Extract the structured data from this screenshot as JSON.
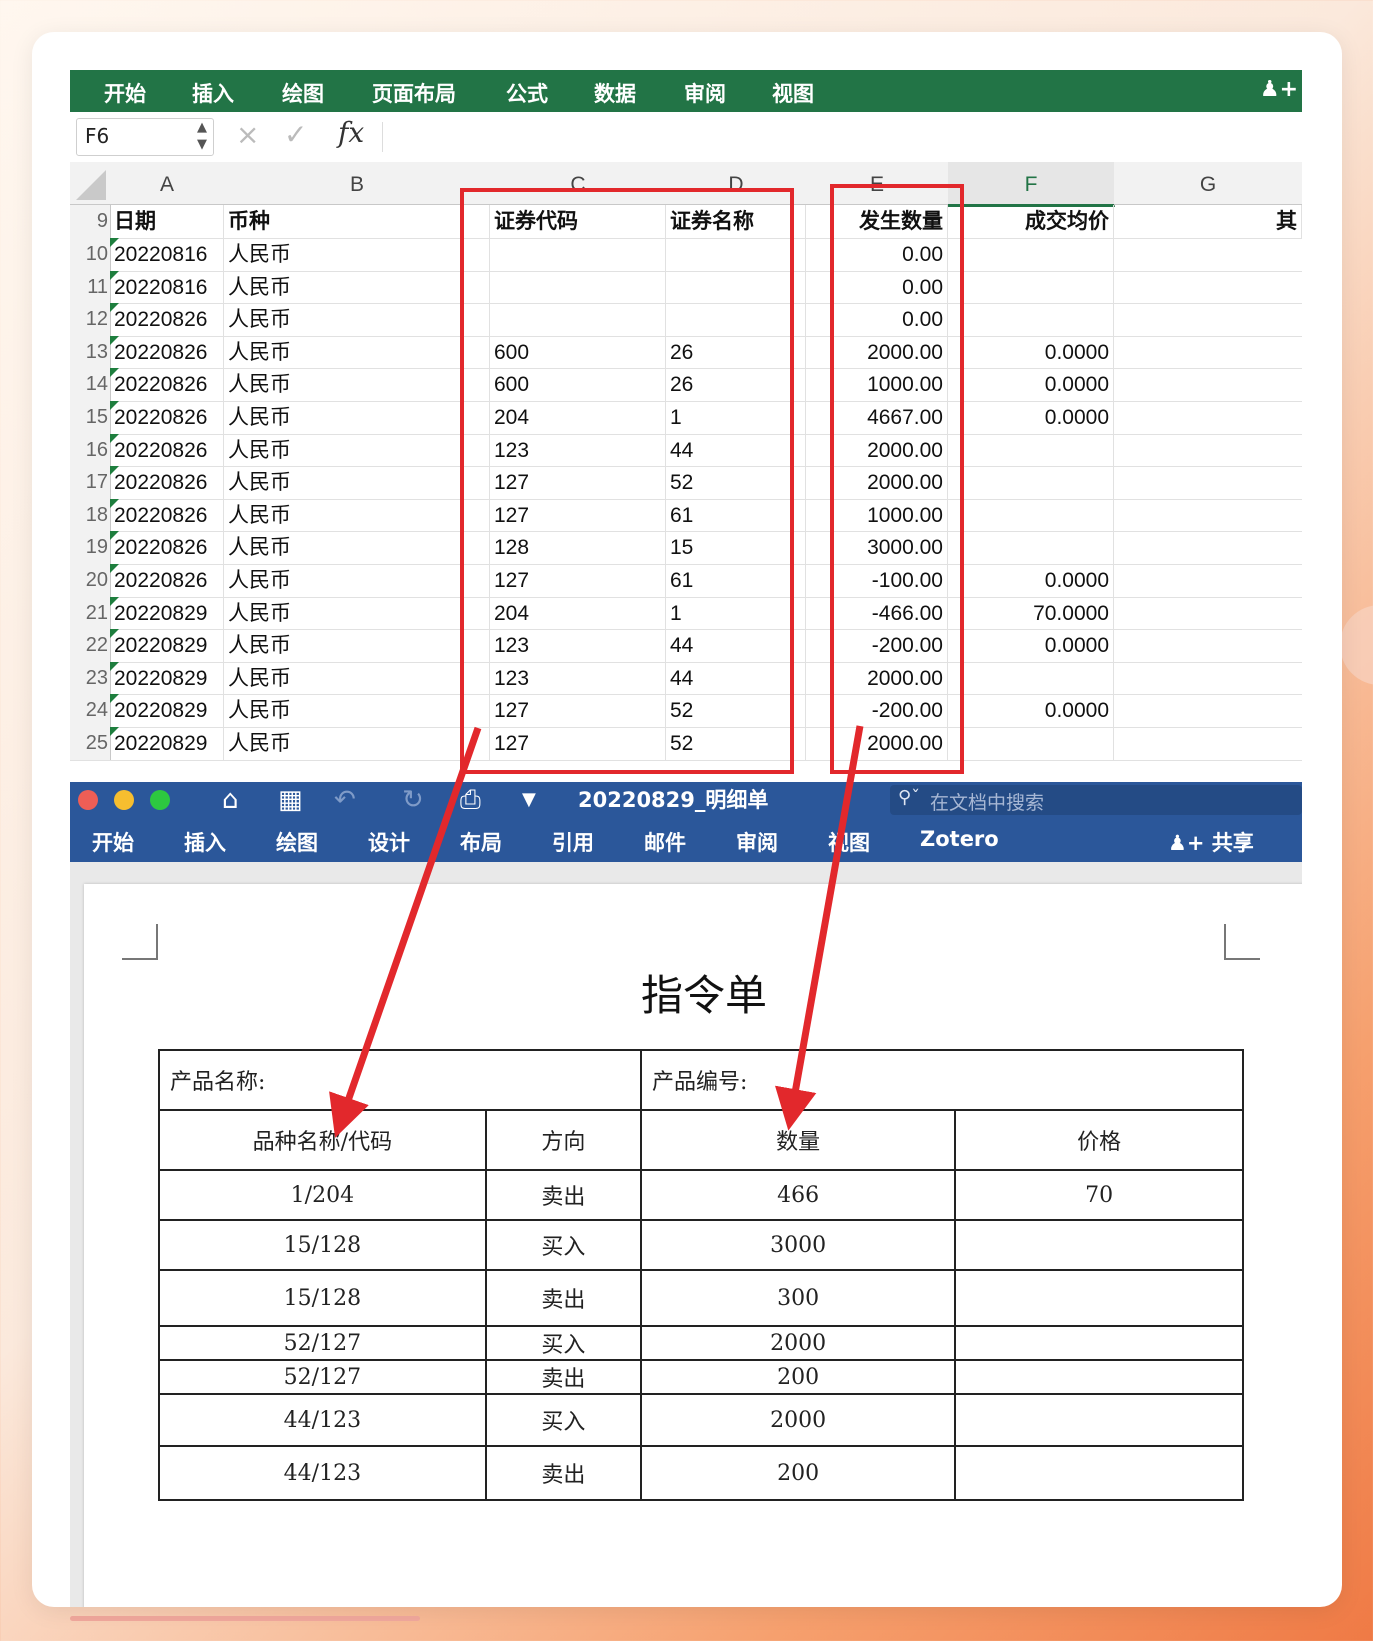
{
  "excel": {
    "ribbon_tabs": [
      "开始",
      "插入",
      "绘图",
      "页面布局",
      "公式",
      "数据",
      "审阅",
      "视图"
    ],
    "share_icon": "add-person-icon",
    "name_box": "F6",
    "formula_icons": {
      "cancel": "×",
      "confirm": "✓",
      "fx": "fx"
    },
    "columns": [
      "A",
      "B",
      "C",
      "D",
      "E",
      "F",
      "G"
    ],
    "selected_column": "F",
    "header_row": {
      "row": "9",
      "date": "日期",
      "currency": "币种",
      "code": "证券代码",
      "name": "证券名称",
      "qty": "发生数量",
      "avg_price": "成交均价",
      "other": "其"
    },
    "rows": [
      {
        "row": "10",
        "date": "20220816",
        "currency": "人民币",
        "code": "",
        "name": "",
        "qty": "0.00",
        "avg_price": ""
      },
      {
        "row": "11",
        "date": "20220816",
        "currency": "人民币",
        "code": "",
        "name": "",
        "qty": "0.00",
        "avg_price": ""
      },
      {
        "row": "12",
        "date": "20220826",
        "currency": "人民币",
        "code": "",
        "name": "",
        "qty": "0.00",
        "avg_price": ""
      },
      {
        "row": "13",
        "date": "20220826",
        "currency": "人民币",
        "code": "600",
        "name": "26",
        "qty": "2000.00",
        "avg_price": "0.0000"
      },
      {
        "row": "14",
        "date": "20220826",
        "currency": "人民币",
        "code": "600",
        "name": "26",
        "qty": "1000.00",
        "avg_price": "0.0000"
      },
      {
        "row": "15",
        "date": "20220826",
        "currency": "人民币",
        "code": "204",
        "name": "1",
        "qty": "4667.00",
        "avg_price": "0.0000"
      },
      {
        "row": "16",
        "date": "20220826",
        "currency": "人民币",
        "code": "123",
        "name": "44",
        "qty": "2000.00",
        "avg_price": ""
      },
      {
        "row": "17",
        "date": "20220826",
        "currency": "人民币",
        "code": "127",
        "name": "52",
        "qty": "2000.00",
        "avg_price": ""
      },
      {
        "row": "18",
        "date": "20220826",
        "currency": "人民币",
        "code": "127",
        "name": "61",
        "qty": "1000.00",
        "avg_price": ""
      },
      {
        "row": "19",
        "date": "20220826",
        "currency": "人民币",
        "code": "128",
        "name": "15",
        "qty": "3000.00",
        "avg_price": ""
      },
      {
        "row": "20",
        "date": "20220826",
        "currency": "人民币",
        "code": "127",
        "name": "61",
        "qty": "-100.00",
        "avg_price": "0.0000"
      },
      {
        "row": "21",
        "date": "20220829",
        "currency": "人民币",
        "code": "204",
        "name": "1",
        "qty": "-466.00",
        "avg_price": "70.0000"
      },
      {
        "row": "22",
        "date": "20220829",
        "currency": "人民币",
        "code": "123",
        "name": "44",
        "qty": "-200.00",
        "avg_price": "0.0000"
      },
      {
        "row": "23",
        "date": "20220829",
        "currency": "人民币",
        "code": "123",
        "name": "44",
        "qty": "2000.00",
        "avg_price": ""
      },
      {
        "row": "24",
        "date": "20220829",
        "currency": "人民币",
        "code": "127",
        "name": "52",
        "qty": "-200.00",
        "avg_price": "0.0000"
      },
      {
        "row": "25",
        "date": "20220829",
        "currency": "人民币",
        "code": "127",
        "name": "52",
        "qty": "2000.00",
        "avg_price": ""
      }
    ]
  },
  "word": {
    "window_dots": [
      "#ee5e56",
      "#f6be2f",
      "#2dc840"
    ],
    "toolbar_icons": [
      "home-icon",
      "save-icon",
      "undo-icon",
      "redo-icon",
      "print-icon",
      "customize-icon"
    ],
    "doc_title": "20220829_明细单",
    "search_placeholder": "在文档中搜索",
    "ribbon_tabs": [
      "开始",
      "插入",
      "绘图",
      "设计",
      "布局",
      "引用",
      "邮件",
      "审阅",
      "视图",
      "Zotero"
    ],
    "share_label": "共享",
    "heading": "指令单",
    "product_name_label": "产品名称:",
    "product_code_label": "产品编号:",
    "table_headers": [
      "品种名称/代码",
      "方向",
      "数量",
      "价格"
    ],
    "table_rows": [
      {
        "item": "1/204",
        "direction": "卖出",
        "qty": "466",
        "price": "70"
      },
      {
        "item": "15/128",
        "direction": "买入",
        "qty": "3000",
        "price": ""
      },
      {
        "item": "15/128",
        "direction": "卖出",
        "qty": "300",
        "price": ""
      },
      {
        "item": "52/127",
        "direction": "买入",
        "qty": "2000",
        "price": ""
      },
      {
        "item": "52/127",
        "direction": "卖出",
        "qty": "200",
        "price": ""
      },
      {
        "item": "44/123",
        "direction": "买入",
        "qty": "2000",
        "price": ""
      },
      {
        "item": "44/123",
        "direction": "卖出",
        "qty": "200",
        "price": ""
      }
    ]
  },
  "colors": {
    "excel_green": "#227446",
    "word_blue": "#2b579a",
    "highlight_red": "#e2282c"
  }
}
